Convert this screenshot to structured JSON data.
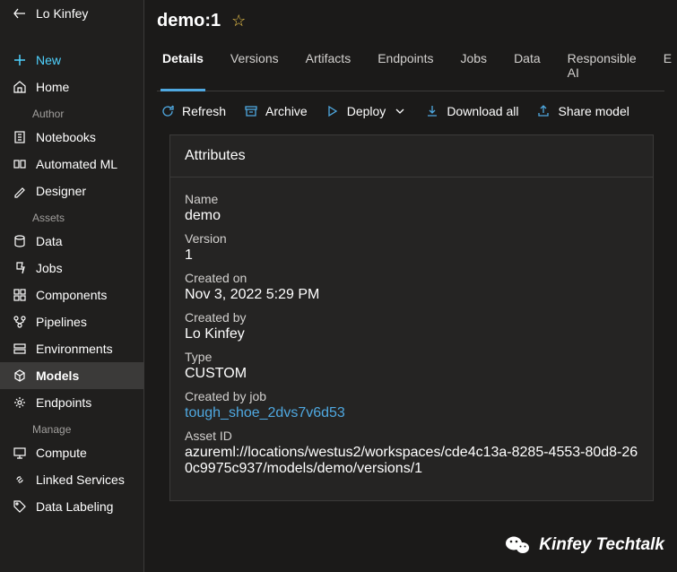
{
  "back_nav": {
    "label": "Lo Kinfey"
  },
  "sidebar": {
    "new_label": "New",
    "home_label": "Home",
    "sections": {
      "author": "Author",
      "assets": "Assets",
      "manage": "Manage"
    },
    "author_items": {
      "notebooks": "Notebooks",
      "automl": "Automated ML",
      "designer": "Designer"
    },
    "asset_items": {
      "data": "Data",
      "jobs": "Jobs",
      "components": "Components",
      "pipelines": "Pipelines",
      "environments": "Environments",
      "models": "Models",
      "endpoints": "Endpoints"
    },
    "manage_items": {
      "compute": "Compute",
      "linked": "Linked Services",
      "labeling": "Data Labeling"
    }
  },
  "header": {
    "title": "demo:1"
  },
  "tabs": {
    "details": "Details",
    "versions": "Versions",
    "artifacts": "Artifacts",
    "endpoints": "Endpoints",
    "jobs": "Jobs",
    "data": "Data",
    "responsible": "Responsible AI",
    "extra": "E"
  },
  "toolbar": {
    "refresh": "Refresh",
    "archive": "Archive",
    "deploy": "Deploy",
    "download": "Download all",
    "share": "Share model"
  },
  "attributes": {
    "header": "Attributes",
    "name_label": "Name",
    "name_value": "demo",
    "version_label": "Version",
    "version_value": "1",
    "created_on_label": "Created on",
    "created_on_value": "Nov 3, 2022 5:29 PM",
    "created_by_label": "Created by",
    "created_by_value": "Lo Kinfey",
    "type_label": "Type",
    "type_value": "CUSTOM",
    "job_label": "Created by job",
    "job_value": "tough_shoe_2dvs7v6d53",
    "asset_id_label": "Asset ID",
    "asset_id_value": "azureml://locations/westus2/workspaces/cde4c13a-8285-4553-80d8-260c9975c937/models/demo/versions/1"
  },
  "watermark": "Kinfey Techtalk"
}
